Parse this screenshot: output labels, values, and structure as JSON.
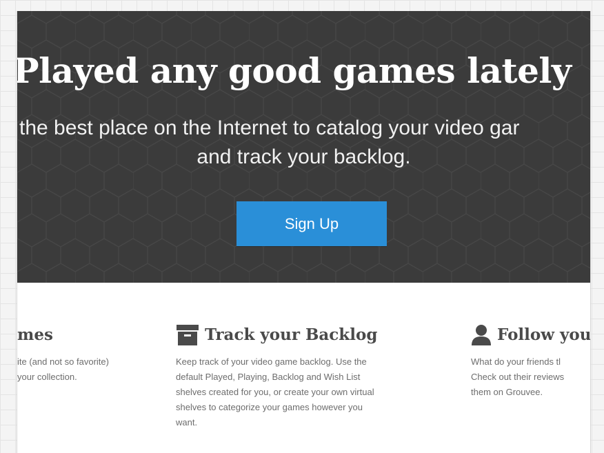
{
  "hero": {
    "title": "Played any good games lately",
    "subtitle_line1": "the best place on the Internet to catalog your video gar",
    "subtitle_line2": "and track your backlog.",
    "signup_label": "Sign Up"
  },
  "features": [
    {
      "title": "mes",
      "icon": "",
      "lines": [
        "ite (and not so favorite)",
        "your collection."
      ]
    },
    {
      "title": "Track your Backlog",
      "icon": "archive-box-icon",
      "lines": [
        "Keep track of your video game backlog. Use the",
        "default Played, Playing, Backlog and Wish List",
        "shelves created for you, or create your own virtual",
        "shelves to categorize your games however you",
        "want."
      ]
    },
    {
      "title": "Follow you",
      "icon": "person-icon",
      "lines": [
        "What do your friends tl",
        "Check out their reviews",
        "them on Grouvee."
      ]
    }
  ],
  "colors": {
    "hero_bg": "#3b3b3b",
    "accent": "#2a8fd8",
    "heading": "#4a4a4a",
    "body_text": "#6d6d6d"
  }
}
